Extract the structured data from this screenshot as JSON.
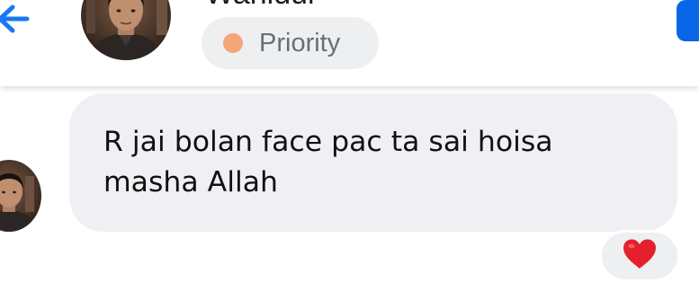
{
  "header": {
    "contact_name": "Wahidul",
    "priority_label": "Priority",
    "colors": {
      "back_arrow": "#1877f2",
      "priority_dot": "#f4a57a",
      "action_button": "#0a66e8"
    }
  },
  "conversation": {
    "message": {
      "text": "R jai bolan face pac ta sai hoisa\nmasha Allah",
      "bubble_color": "#f0f0f4",
      "reaction": {
        "icon": "heart-icon",
        "color": "#e5202e"
      }
    }
  }
}
